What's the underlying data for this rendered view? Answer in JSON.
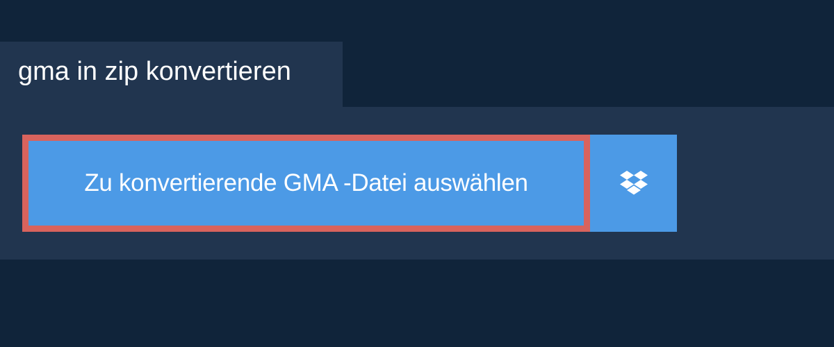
{
  "header": {
    "title": "gma in zip konvertieren"
  },
  "upload": {
    "select_file_label": "Zu konvertierende GMA -Datei auswählen",
    "dropbox_icon": "dropbox-icon"
  },
  "colors": {
    "background": "#10243a",
    "panel": "#21354f",
    "button": "#4c9ae6",
    "button_highlight_border": "#d9635d",
    "text": "#ffffff"
  }
}
